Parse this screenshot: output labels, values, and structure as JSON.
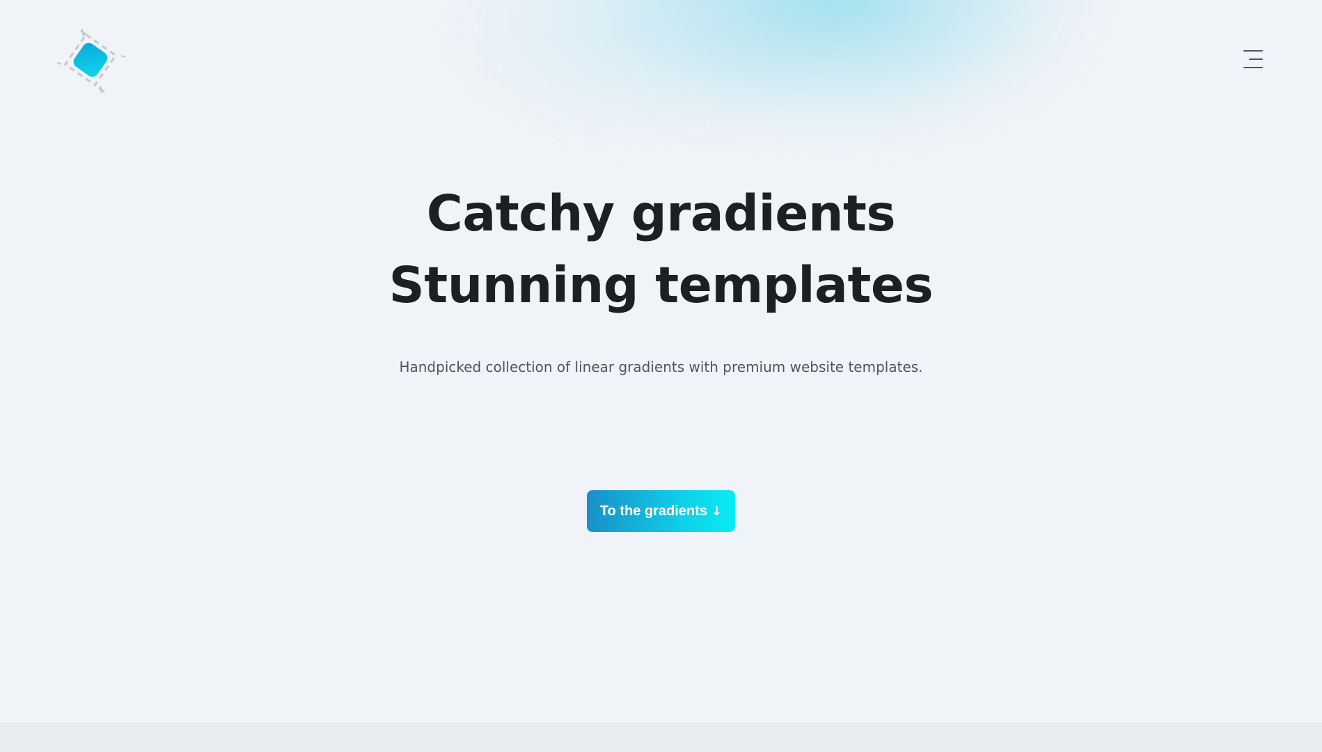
{
  "header": {
    "logo_icon": "gradient-diamond-logo-icon",
    "menu_icon": "hamburger-menu-icon"
  },
  "hero": {
    "headline_line1": "Catchy gradients",
    "headline_line2": "Stunning templates",
    "subtitle": "Handpicked collection of linear gradients with premium website templates.",
    "cta_label": "To the gradients",
    "cta_arrow": "↓"
  },
  "colors": {
    "background": "#f0f4f8",
    "text": "#1c2024",
    "accent_start": "#1a8fc8",
    "accent_end": "#08ecf4"
  }
}
